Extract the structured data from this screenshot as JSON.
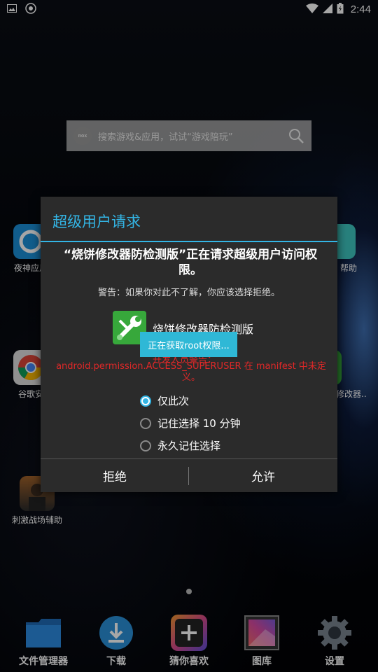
{
  "status_bar": {
    "time": "2:44",
    "left_icons": [
      "image-icon",
      "nox-icon"
    ],
    "right_icons": [
      "wifi-icon",
      "signal-icon",
      "battery-icon"
    ]
  },
  "search": {
    "logo_text": "nox",
    "placeholder": "搜索游戏&应用，试试“游戏陪玩”"
  },
  "desktop_apps": [
    {
      "label": "夜神应用",
      "icon": "nox-app-icon"
    },
    {
      "label": "谷歌安",
      "icon": "chrome-icon"
    },
    {
      "label": "刺激战场辅助",
      "icon": "pubg-icon"
    },
    {
      "label": "帮助",
      "icon": "help-icon"
    },
    {
      "label": "修改器..",
      "icon": "modifier-icon"
    }
  ],
  "dock": [
    {
      "label": "文件管理器",
      "icon": "folder-icon"
    },
    {
      "label": "下载",
      "icon": "download-icon"
    },
    {
      "label": "猜你喜欢",
      "icon": "plus-icon"
    },
    {
      "label": "图库",
      "icon": "gallery-icon"
    },
    {
      "label": "设置",
      "icon": "gear-icon"
    }
  ],
  "dialog": {
    "title": "超级用户请求",
    "message": "“烧饼修改器防检测版”正在请求超级用户访问权限。",
    "warning": "警告：如果你对此不了解，你应该选择拒绝。",
    "app_name": "烧饼修改器防检测版",
    "error_behind": "开发人员警告：",
    "error": "android.permission.ACCESS_SUPERUSER 在 manifest 中未定义。",
    "options": [
      {
        "label": "仅此次",
        "checked": true
      },
      {
        "label": "记住选择 10 分钟",
        "checked": false
      },
      {
        "label": "永久记住选择",
        "checked": false
      }
    ],
    "deny_label": "拒绝",
    "allow_label": "允许"
  },
  "toast": "正在获取root权限..."
}
